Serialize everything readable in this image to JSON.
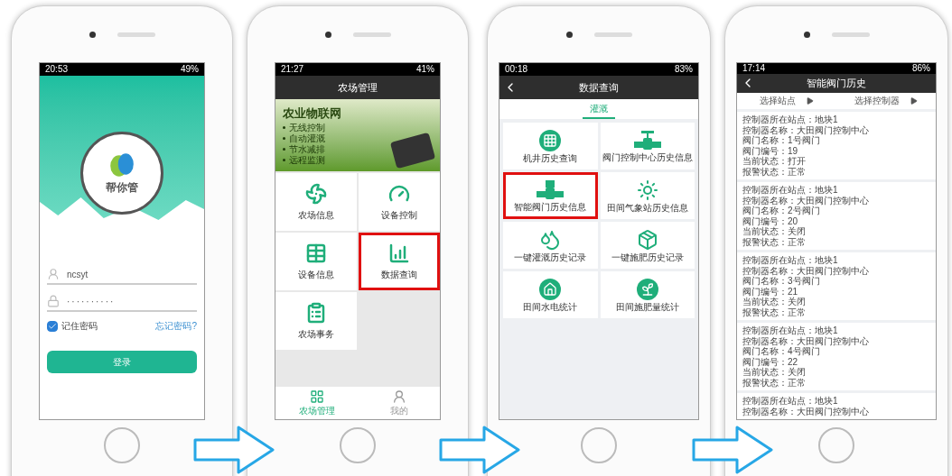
{
  "phones": [
    {
      "kind": "login",
      "status_bar": {
        "time": "20:53",
        "battery": "49%"
      },
      "logo_text": "帮你管",
      "username": "ncsyt",
      "password": "··········",
      "remember": {
        "label": "记住密码",
        "checked": true
      },
      "forgot_link": "忘记密码?",
      "login_button": "登录"
    },
    {
      "kind": "home",
      "status_bar": {
        "time": "21:27",
        "battery": "41%"
      },
      "title": "农场管理",
      "banner": {
        "headline": "农业物联网",
        "bullets": [
          "无线控制",
          "自动灌溉",
          "节水减排",
          "远程监测"
        ]
      },
      "tiles": [
        {
          "label": "农场信息",
          "highlighted": false
        },
        {
          "label": "设备控制",
          "highlighted": false
        },
        {
          "label": "设备信息",
          "highlighted": false
        },
        {
          "label": "数据查询",
          "highlighted": true
        },
        {
          "label": "农场事务",
          "highlighted": false
        }
      ],
      "tab_bar": [
        {
          "label": "农场管理",
          "selected": true
        },
        {
          "label": "我的",
          "selected": false
        }
      ]
    },
    {
      "kind": "query",
      "status_bar": {
        "time": "00:18",
        "battery": "83%"
      },
      "title": "数据查询",
      "tabs": [
        {
          "label": "灌溉",
          "selected": true
        }
      ],
      "tiles": [
        {
          "label": "机井历史查询",
          "highlighted": false
        },
        {
          "label": "阀门控制中心历史信息",
          "highlighted": false
        },
        {
          "label": "智能阀门历史信息",
          "highlighted": true
        },
        {
          "label": "田间气象站历史信息",
          "highlighted": false
        },
        {
          "label": "一键灌溉历史记录",
          "highlighted": false
        },
        {
          "label": "一键施肥历史记录",
          "highlighted": false
        },
        {
          "label": "田间水电统计",
          "highlighted": false
        },
        {
          "label": "田间施肥量统计",
          "highlighted": false
        }
      ]
    },
    {
      "kind": "history",
      "status_bar": {
        "time": "17:14",
        "battery": "86%"
      },
      "title": "智能阀门历史",
      "filters": [
        {
          "label": "选择站点"
        },
        {
          "label": "选择控制器"
        }
      ],
      "records": [
        {
          "lines": [
            "控制器所在站点：地块1",
            "控制器名称：大田阀门控制中心",
            "阀门名称：1号阀门",
            "阀门编号：19",
            "当前状态：打开",
            "报警状态：正常"
          ]
        },
        {
          "lines": [
            "控制器所在站点：地块1",
            "控制器名称：大田阀门控制中心",
            "阀门名称：2号阀门",
            "阀门编号：20",
            "当前状态：关闭",
            "报警状态：正常"
          ]
        },
        {
          "lines": [
            "控制器所在站点：地块1",
            "控制器名称：大田阀门控制中心",
            "阀门名称：3号阀门",
            "阀门编号：21",
            "当前状态：关闭",
            "报警状态：正常"
          ]
        },
        {
          "lines": [
            "控制器所在站点：地块1",
            "控制器名称：大田阀门控制中心",
            "阀门名称：4号阀门",
            "阀门编号：22",
            "当前状态：关闭",
            "报警状态：正常"
          ]
        },
        {
          "lines": [
            "控制器所在站点：地块1",
            "控制器名称：大田阀门控制中心"
          ]
        }
      ]
    }
  ]
}
